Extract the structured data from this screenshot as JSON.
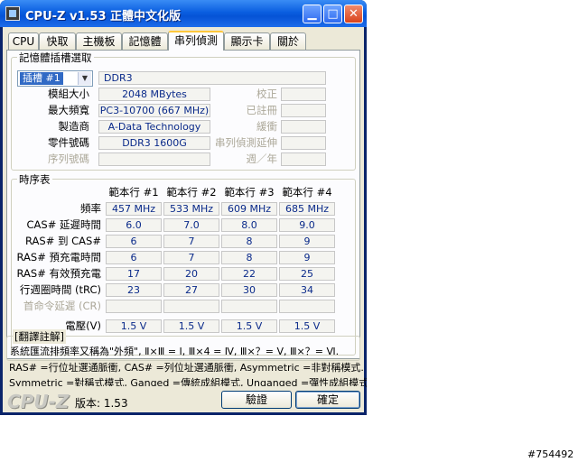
{
  "window": {
    "title": "CPU-Z v1.53 正體中文化版"
  },
  "tabs": [
    "CPU",
    "快取",
    "主機板",
    "記憶體",
    "串列偵測",
    "顯示卡",
    "關於"
  ],
  "spd": {
    "group_label": "記憶體插槽選取",
    "slot_select": "插槽 #1",
    "mem_type": "DDR3",
    "rows": [
      {
        "label": "模組大小",
        "value": "2048 MBytes",
        "rlabel": "校正",
        "rvalue": ""
      },
      {
        "label": "最大頻寬",
        "value": "PC3-10700 (667 MHz)",
        "rlabel": "已註冊",
        "rvalue": ""
      },
      {
        "label": "製造商",
        "value": "A-Data Technology",
        "rlabel": "緩衝",
        "rvalue": ""
      },
      {
        "label": "零件號碼",
        "value": "DDR3 1600G",
        "rlabel": "串列偵測延伸",
        "rvalue": ""
      },
      {
        "label": "序列號碼",
        "value": "",
        "rlabel": "週／年",
        "rvalue": ""
      }
    ]
  },
  "timings": {
    "group_label": "時序表",
    "columns": [
      "範本行 #1",
      "範本行 #2",
      "範本行 #3",
      "範本行 #4"
    ],
    "rows": [
      {
        "label": "頻率",
        "values": [
          "457 MHz",
          "533 MHz",
          "609 MHz",
          "685 MHz"
        ]
      },
      {
        "label": "CAS# 延遲時間",
        "values": [
          "6.0",
          "7.0",
          "8.0",
          "9.0"
        ]
      },
      {
        "label": "RAS# 到 CAS#",
        "values": [
          "6",
          "7",
          "8",
          "9"
        ]
      },
      {
        "label": "RAS# 預充電時間",
        "values": [
          "6",
          "7",
          "8",
          "9"
        ]
      },
      {
        "label": "RAS# 有效預充電",
        "values": [
          "17",
          "20",
          "22",
          "25"
        ]
      },
      {
        "label": "行週圈時間 (tRC)",
        "values": [
          "23",
          "27",
          "30",
          "34"
        ]
      },
      {
        "label": "首命令延遲 (CR)",
        "values": [
          "",
          "",
          "",
          ""
        ]
      },
      {
        "label": "電壓(V)",
        "values": [
          "1.5 V",
          "1.5 V",
          "1.5 V",
          "1.5 V"
        ]
      }
    ]
  },
  "notes": {
    "label": "[翻譯註解]",
    "lines": [
      "系統匯流排頻率又稱為\"外頻\", Ⅱ×Ⅲ = Ⅰ, Ⅲ×4 = Ⅳ, Ⅲ×？= Ⅴ, Ⅲ×？= Ⅵ.",
      "RAS# =行位址選通脈衝, CAS# =列位址選通脈衝, Asymmetric =非對稱模式.",
      "Symmetric =對稱式模式, Ganged =傳統成組模式, Unganged =彈性成組模式."
    ]
  },
  "footer": {
    "brand": "CPU-Z",
    "version": "版本: 1.53",
    "validate_label": "驗證",
    "ok_label": "確定"
  },
  "watermark": "#754492"
}
